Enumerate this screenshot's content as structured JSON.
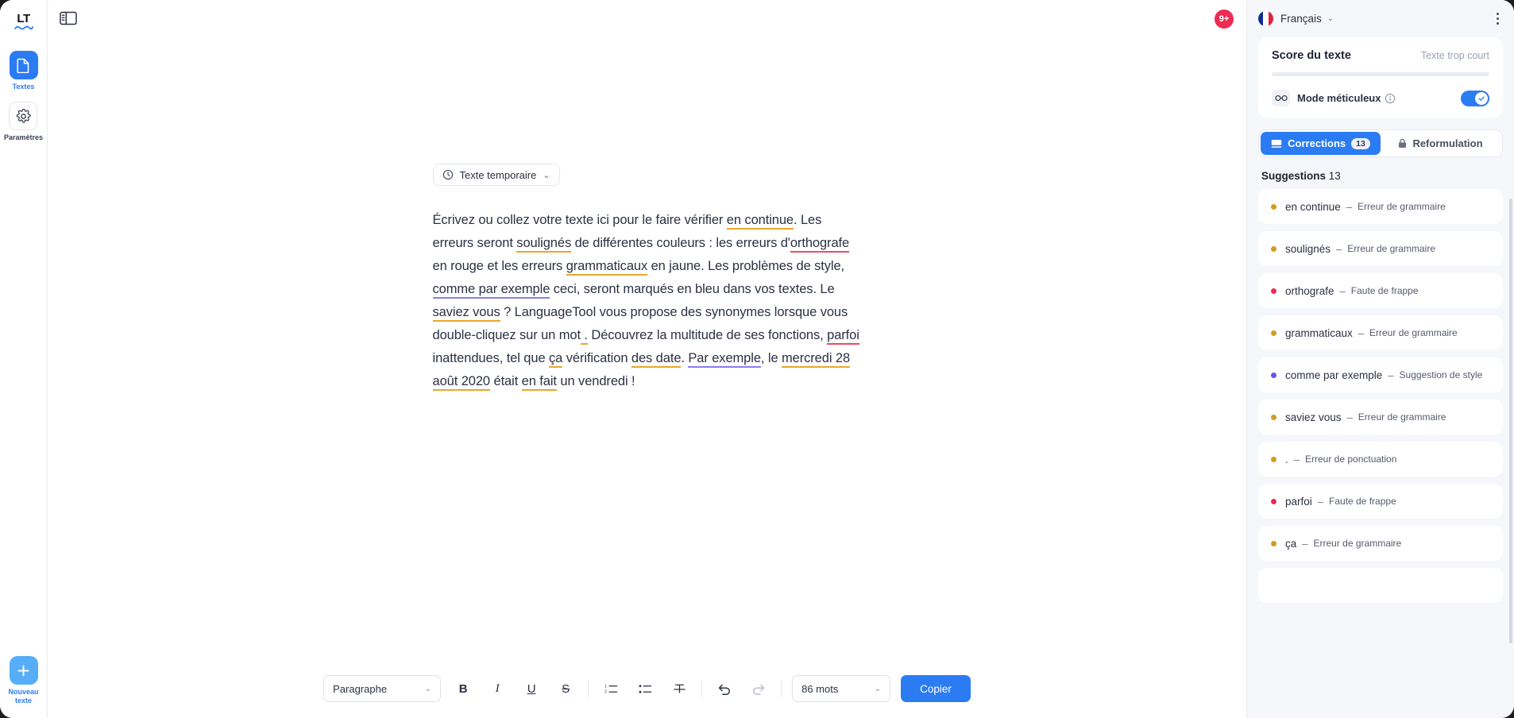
{
  "app": {
    "logo_text": "LT"
  },
  "sidebar": {
    "items": [
      {
        "label": "Textes",
        "icon": "document-icon",
        "active": true
      },
      {
        "label": "Paramètres",
        "icon": "gear-icon",
        "active": false
      }
    ],
    "new_text_label": "Nouveau\ntexte",
    "new_text_label_line1": "Nouveau",
    "new_text_label_line2": "texte"
  },
  "center": {
    "panel_toggle_icon": "panel-toggle-icon",
    "notification_badge": "9+",
    "document_chip": {
      "label": "Texte temporaire",
      "icon": "clock-icon",
      "chevron": "⌄"
    },
    "document_text": {
      "segments": [
        {
          "t": "Écrivez ou collez votre texte ici pour le faire vérifier ",
          "k": "plain"
        },
        {
          "t": "en continue",
          "k": "gram"
        },
        {
          "t": ". Les erreurs seront ",
          "k": "plain"
        },
        {
          "t": "soulignés",
          "k": "gram"
        },
        {
          "t": " de différentes couleurs : les erreurs d'",
          "k": "plain"
        },
        {
          "t": "orthografe",
          "k": "spell"
        },
        {
          "t": " en rouge et les erreurs ",
          "k": "plain"
        },
        {
          "t": "grammaticaux",
          "k": "gram"
        },
        {
          "t": " en jaune. Les problèmes de style, ",
          "k": "plain"
        },
        {
          "t": "comme par exemple",
          "k": "style"
        },
        {
          "t": " ceci, seront marqués en bleu dans vos textes. Le ",
          "k": "plain"
        },
        {
          "t": "saviez vous",
          "k": "gram"
        },
        {
          "t": " ? LanguageTool vous propose des synonymes lorsque vous double-cliquez sur un mot",
          "k": "plain"
        },
        {
          "t": " .",
          "k": "gram"
        },
        {
          "t": " Découvrez la multitude de ses fonctions, ",
          "k": "plain"
        },
        {
          "t": "parfoi",
          "k": "spell"
        },
        {
          "t": " inattendues, tel que ",
          "k": "plain"
        },
        {
          "t": "ça",
          "k": "gram"
        },
        {
          "t": " vérification ",
          "k": "plain"
        },
        {
          "t": "des date",
          "k": "gram"
        },
        {
          "t": ". ",
          "k": "plain"
        },
        {
          "t": "Par exemple",
          "k": "style"
        },
        {
          "t": ", le ",
          "k": "plain"
        },
        {
          "t": "mercredi 28 août 2020",
          "k": "gram"
        },
        {
          "t": " était ",
          "k": "plain"
        },
        {
          "t": "en fait",
          "k": "gram"
        },
        {
          "t": " un vendredi !",
          "k": "plain"
        }
      ]
    }
  },
  "toolbar": {
    "paragraph_select": {
      "value": "Paragraphe",
      "chevron": "⌄"
    },
    "bold_label": "B",
    "italic_label": "I",
    "underline_label": "U",
    "strikethrough_label": "S",
    "numbered_list_icon": "numbered-list-icon",
    "bulleted_list_icon": "bulleted-list-icon",
    "clear_format_icon": "clear-format-icon",
    "undo_icon": "undo-icon",
    "redo_icon": "redo-icon",
    "word_count_select": {
      "value": "86 mots",
      "chevron": "⌄"
    },
    "copy_label": "Copier"
  },
  "right": {
    "language": {
      "name": "Français",
      "chevron": "⌄",
      "flag": "french-flag-icon"
    },
    "menu_icon": "more-options-icon",
    "score": {
      "title": "Score du texte",
      "status": "Texte trop court",
      "progress_percent": 0
    },
    "meticulous": {
      "label": "Mode méticuleux",
      "icon": "glasses-icon",
      "info_icon": "info-icon",
      "enabled": true
    },
    "tabs": [
      {
        "label": "Corrections",
        "count": "13",
        "icon": "corrections-icon",
        "active": true
      },
      {
        "label": "Reformulation",
        "icon": "lock-icon",
        "active": false
      }
    ],
    "suggestions_header": {
      "title": "Suggestions",
      "count": "13"
    },
    "suggestions": [
      {
        "word": "en continue",
        "dash": "–",
        "type": "Erreur de grammaire",
        "color": "#d49b1f"
      },
      {
        "word": "soulignés",
        "dash": "–",
        "type": "Erreur de grammaire",
        "color": "#d49b1f"
      },
      {
        "word": "orthografe",
        "dash": "–",
        "type": "Faute de frappe",
        "color": "#ee2a53"
      },
      {
        "word": "grammaticaux",
        "dash": "–",
        "type": "Erreur de grammaire",
        "color": "#d49b1f"
      },
      {
        "word": "comme par exemple",
        "dash": "–",
        "type": "Suggestion de style",
        "color": "#6b52ef"
      },
      {
        "word": "saviez vous",
        "dash": "–",
        "type": "Erreur de grammaire",
        "color": "#d49b1f"
      },
      {
        "word": ".",
        "dash": "–",
        "type": "Erreur de ponctuation",
        "color": "#d49b1f"
      },
      {
        "word": "parfoi",
        "dash": "–",
        "type": "Faute de frappe",
        "color": "#ee2a53"
      },
      {
        "word": "ça",
        "dash": "–",
        "type": "Erreur de grammaire",
        "color": "#d49b1f"
      }
    ]
  },
  "colors": {
    "accent": "#2b7cf3",
    "grammar": "#e8a72c",
    "spelling": "#ef4a62",
    "style": "#8a7df0",
    "badge_red": "#ed2b53"
  }
}
